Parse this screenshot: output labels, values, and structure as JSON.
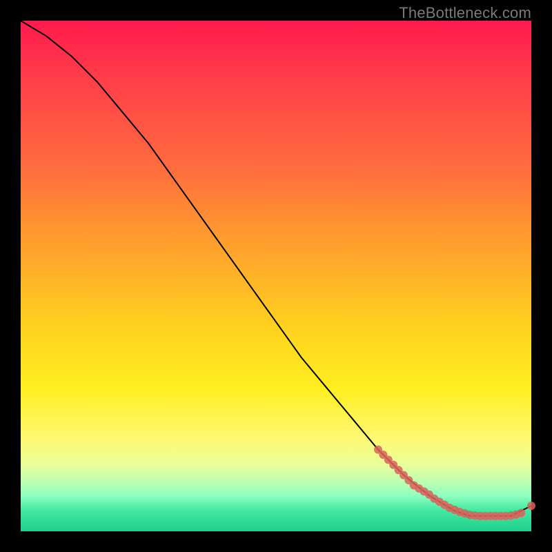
{
  "attribution": "TheBottleneck.com",
  "chart_data": {
    "type": "line",
    "title": "",
    "xlabel": "",
    "ylabel": "",
    "xlim": [
      0,
      100
    ],
    "ylim": [
      0,
      100
    ],
    "grid": false,
    "series": [
      {
        "name": "curve",
        "style": "line",
        "color": "#000000",
        "x": [
          0,
          5,
          10,
          15,
          20,
          25,
          30,
          35,
          40,
          45,
          50,
          55,
          60,
          65,
          70,
          75,
          80,
          85,
          88,
          92,
          96,
          100
        ],
        "values": [
          100,
          97,
          93,
          88,
          82,
          76,
          69,
          62,
          55,
          48,
          41,
          34,
          28,
          22,
          16,
          11,
          7,
          4,
          3,
          3,
          3,
          5
        ]
      },
      {
        "name": "marks-on-curve",
        "style": "scatter",
        "color": "#d9615a",
        "x": [
          70,
          71,
          72,
          73,
          74,
          75,
          76,
          77,
          78,
          79,
          80,
          81,
          82,
          83,
          84,
          85,
          86,
          87,
          88,
          89,
          90,
          91,
          92,
          93,
          94,
          95,
          96,
          97,
          98,
          100
        ],
        "values": [
          16,
          15,
          14,
          13,
          12,
          11,
          10,
          9,
          8.4,
          7.8,
          7.2,
          6.4,
          5.8,
          5.2,
          4.6,
          4.2,
          3.8,
          3.5,
          3.2,
          3.1,
          3.0,
          3.0,
          3.0,
          3.0,
          3.0,
          3.0,
          3.1,
          3.3,
          3.6,
          5
        ]
      }
    ]
  }
}
